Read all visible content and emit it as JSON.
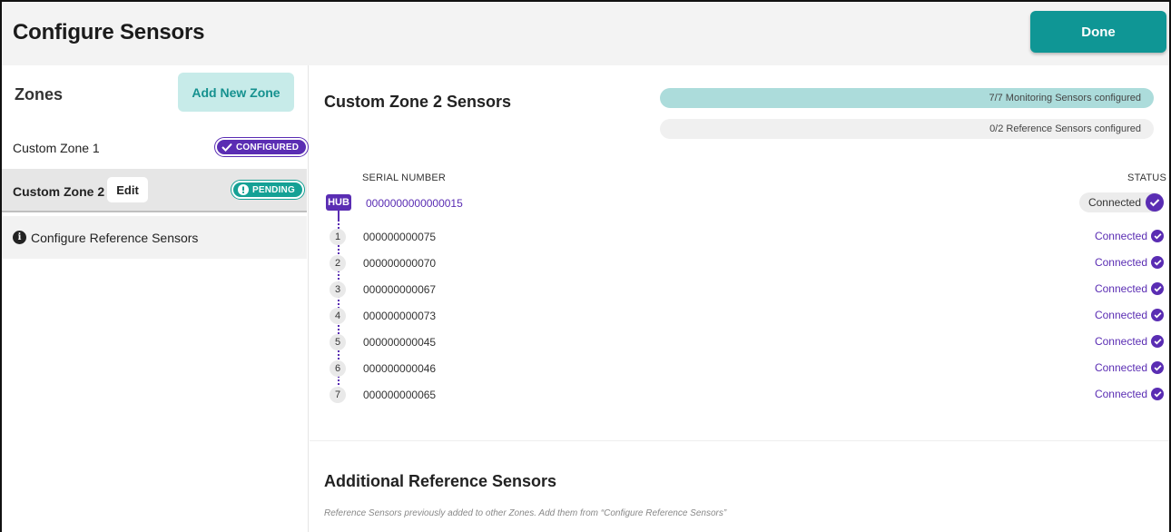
{
  "header": {
    "title": "Configure Sensors",
    "done_label": "Done"
  },
  "sidebar": {
    "zones_title": "Zones",
    "add_zone_label": "Add New Zone",
    "zones": [
      {
        "name": "Custom Zone 1",
        "badge": "CONFIGURED"
      },
      {
        "name": "Custom Zone 2",
        "edit_label": "Edit",
        "badge": "PENDING"
      }
    ],
    "reference_link": "Configure Reference Sensors"
  },
  "main": {
    "zone_title": "Custom Zone 2 Sensors",
    "monitoring_progress": {
      "label": "7/7 Monitoring Sensors configured",
      "configured": 7,
      "total": 7
    },
    "reference_progress": {
      "label": "0/2 Reference Sensors configured",
      "configured": 0,
      "total": 2
    },
    "columns": {
      "serial": "SERIAL NUMBER",
      "status": "STATUS"
    },
    "hub": {
      "label": "HUB",
      "serial": "0000000000000015",
      "status": "Connected"
    },
    "sensors": [
      {
        "num": "1",
        "serial": "000000000075",
        "status": "Connected"
      },
      {
        "num": "2",
        "serial": "000000000070",
        "status": "Connected"
      },
      {
        "num": "3",
        "serial": "000000000067",
        "status": "Connected"
      },
      {
        "num": "4",
        "serial": "000000000073",
        "status": "Connected"
      },
      {
        "num": "5",
        "serial": "000000000045",
        "status": "Connected"
      },
      {
        "num": "6",
        "serial": "000000000046",
        "status": "Connected"
      },
      {
        "num": "7",
        "serial": "000000000065",
        "status": "Connected"
      }
    ],
    "additional_title": "Additional Reference Sensors",
    "additional_subtitle": "Reference Sensors previously added to other Zones. Add them from “Configure Reference Sensors”"
  },
  "colors": {
    "brand_teal": "#0f9695",
    "accent_purple": "#5a2db3",
    "pending_teal": "#15a195"
  }
}
